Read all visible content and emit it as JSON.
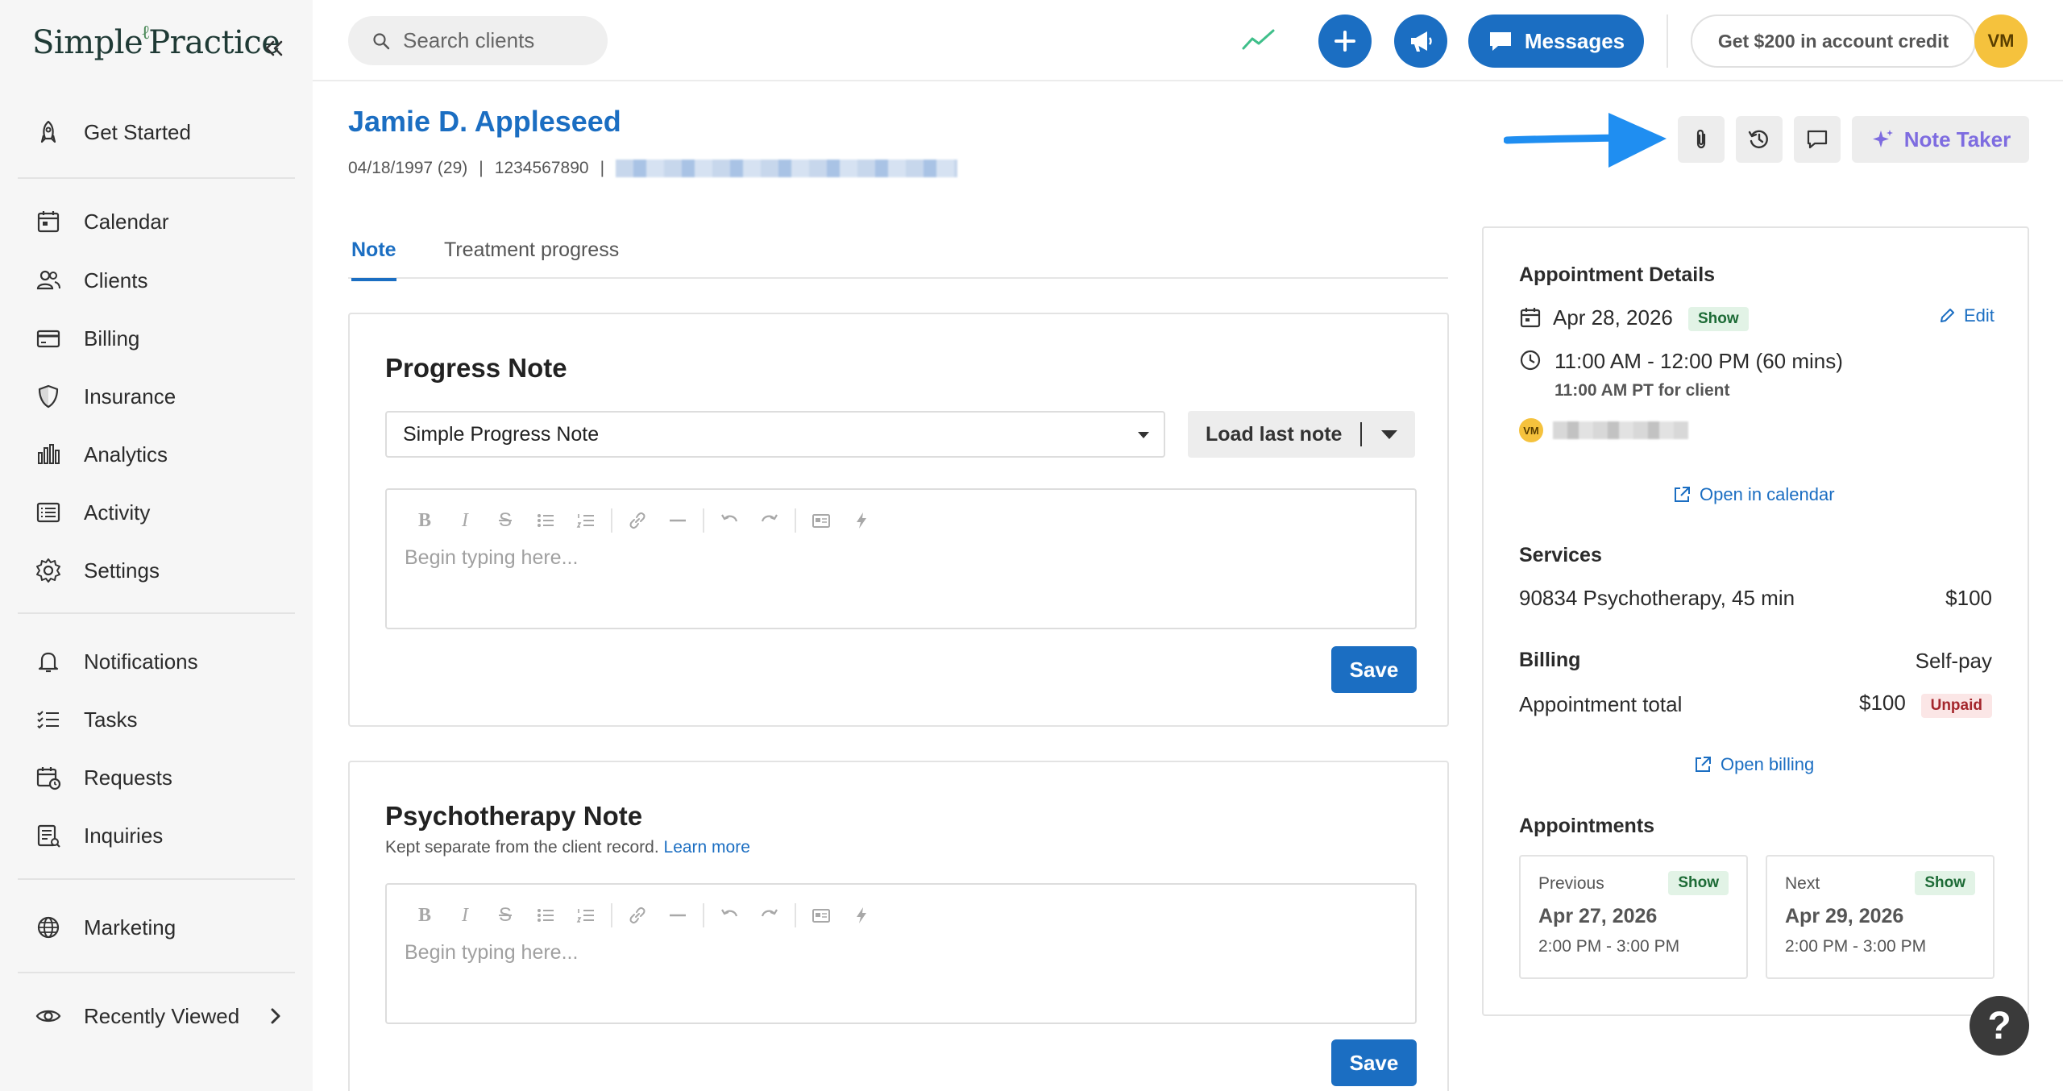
{
  "app": {
    "logo_text_1": "Simple",
    "logo_leaf": "ℓ",
    "logo_text_2": "Practice"
  },
  "sidebar": {
    "items": [
      {
        "label": "Get Started",
        "icon": "rocket-icon"
      },
      {
        "label": "Calendar",
        "icon": "calendar-icon"
      },
      {
        "label": "Clients",
        "icon": "users-icon"
      },
      {
        "label": "Billing",
        "icon": "credit-card-icon"
      },
      {
        "label": "Insurance",
        "icon": "shield-icon"
      },
      {
        "label": "Analytics",
        "icon": "bar-chart-icon"
      },
      {
        "label": "Activity",
        "icon": "list-icon"
      },
      {
        "label": "Settings",
        "icon": "gear-icon"
      },
      {
        "label": "Notifications",
        "icon": "bell-icon"
      },
      {
        "label": "Tasks",
        "icon": "checklist-icon"
      },
      {
        "label": "Requests",
        "icon": "calendar-clock-icon"
      },
      {
        "label": "Inquiries",
        "icon": "inquiry-icon"
      },
      {
        "label": "Marketing",
        "icon": "globe-icon"
      },
      {
        "label": "Recently Viewed",
        "icon": "eye-icon"
      }
    ]
  },
  "topbar": {
    "search_placeholder": "Search clients",
    "messages_label": "Messages",
    "credit_label": "Get $200 in account credit",
    "avatar_initials": "VM"
  },
  "client": {
    "name": "Jamie D. Appleseed",
    "dob": "04/18/1997 (29)",
    "sep": "|",
    "phone": "1234567890"
  },
  "tabs": [
    {
      "label": "Note",
      "active": true
    },
    {
      "label": "Treatment progress",
      "active": false
    }
  ],
  "progress_note": {
    "title": "Progress Note",
    "template_selected": "Simple Progress Note",
    "load_last_label": "Load last note",
    "placeholder": "Begin typing here...",
    "save_label": "Save"
  },
  "psychotherapy_note": {
    "title": "Psychotherapy Note",
    "subtitle": "Kept separate from the client record.",
    "learn_more": "Learn more",
    "placeholder": "Begin typing here...",
    "save_label": "Save"
  },
  "actions": {
    "note_taker_label": "Note Taker"
  },
  "appointment": {
    "heading": "Appointment Details",
    "date": "Apr 28, 2026",
    "status": "Show",
    "edit_label": "Edit",
    "time": "11:00 AM - 12:00 PM (60 mins)",
    "client_time": "11:00 AM PT for client",
    "clinician_initials": "VM",
    "open_calendar": "Open in calendar"
  },
  "services": {
    "heading": "Services",
    "item": "90834 Psychotherapy, 45 min",
    "price": "$100"
  },
  "billing": {
    "heading": "Billing",
    "type": "Self-pay",
    "total_label": "Appointment total",
    "total_value": "$100",
    "status": "Unpaid",
    "open_billing": "Open billing"
  },
  "appointments": {
    "heading": "Appointments",
    "previous": {
      "label": "Previous",
      "status": "Show",
      "date": "Apr 27, 2026",
      "time": "2:00 PM - 3:00 PM"
    },
    "next": {
      "label": "Next",
      "status": "Show",
      "date": "Apr 29, 2026",
      "time": "2:00 PM - 3:00 PM"
    }
  },
  "help_label": "?",
  "colors": {
    "primary": "#1b6ec2",
    "accent_purple": "#7e6ce0",
    "avatar_yellow": "#f5c23d",
    "annotation_arrow": "#1f8ef1"
  }
}
